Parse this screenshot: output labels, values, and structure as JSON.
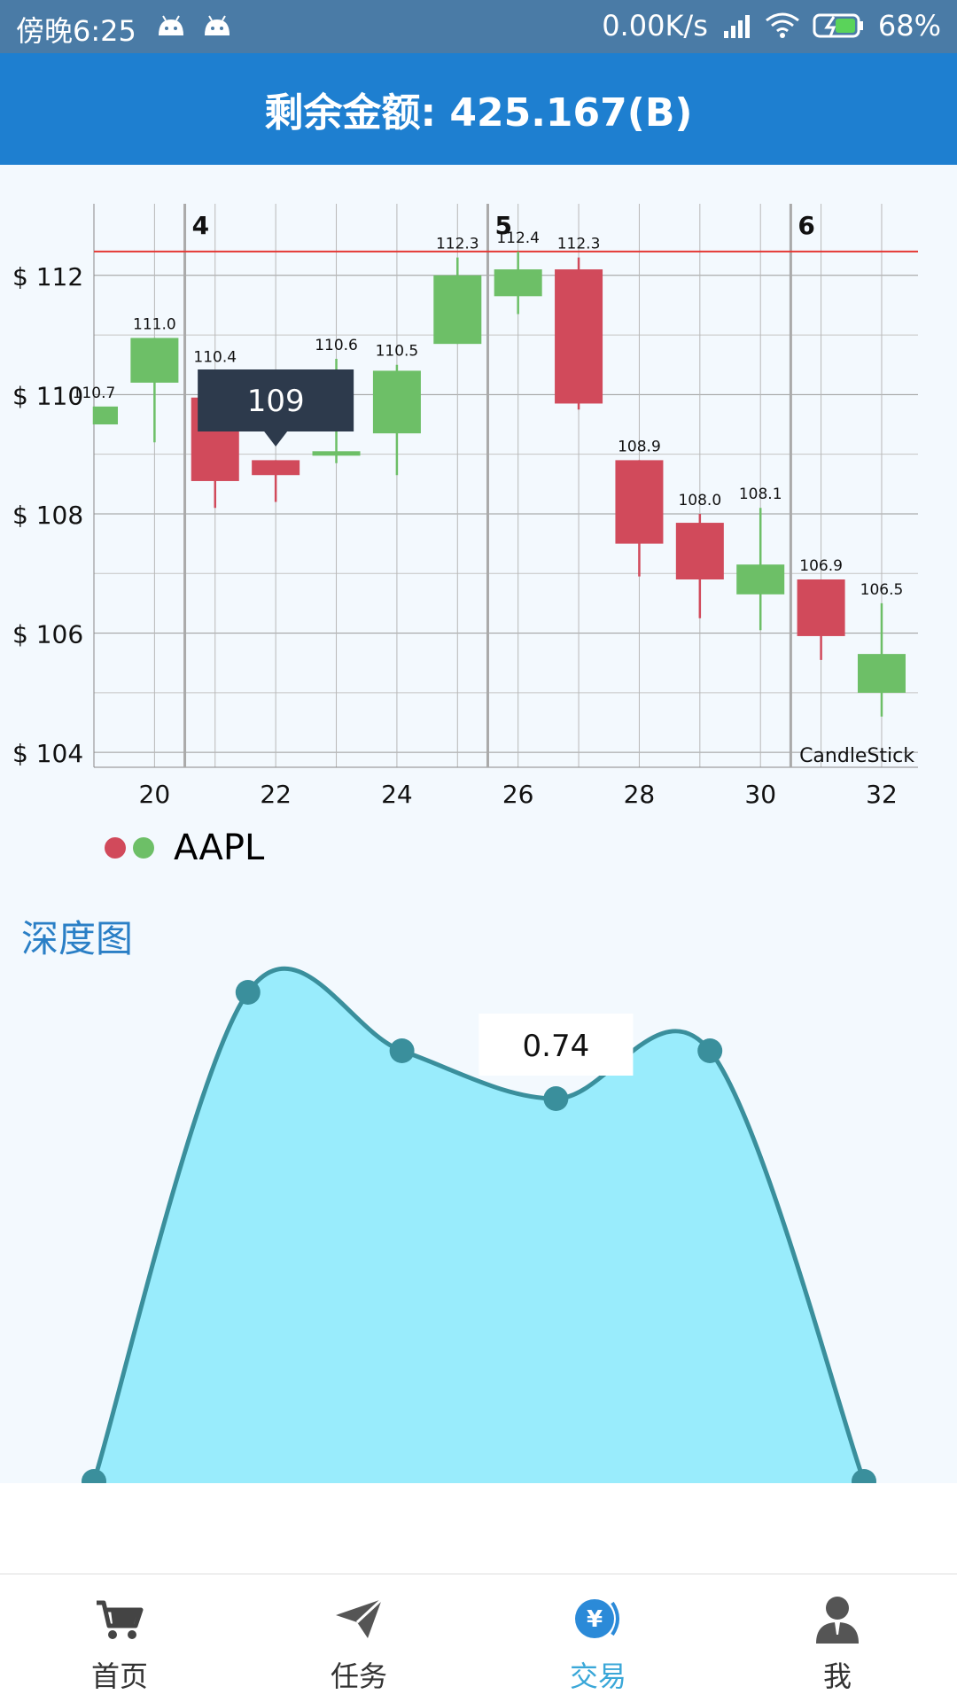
{
  "status_bar": {
    "time": "傍晚6:25",
    "network_speed": "0.00K/s",
    "battery": "68%",
    "icons": [
      "android-icon",
      "android-icon",
      "hd-signal-icon",
      "wifi-icon",
      "battery-charging-icon"
    ]
  },
  "header": {
    "title": "剩余金额: 425.167(B)"
  },
  "candlestick_chart": {
    "title": "CandleStick",
    "series_name": "AAPL",
    "colors": {
      "up": "#6dbf67",
      "down": "#d14a5b",
      "limit_line": "#e53935",
      "tooltip_bg": "#2d3a4c"
    },
    "tooltip_value": "109",
    "week_labels": [
      "4",
      "5",
      "6"
    ]
  },
  "depth_chart": {
    "title": "深度图",
    "tooltip_value": "0.74",
    "colors": {
      "fill": "#99ecfc",
      "line": "#3a8f9c"
    }
  },
  "chart_data": [
    {
      "type": "candlestick",
      "title": "CandleStick",
      "series": [
        {
          "name": "AAPL"
        }
      ],
      "x": [
        19,
        20,
        21,
        22,
        23,
        24,
        25,
        26,
        27,
        28,
        29,
        30,
        31,
        32
      ],
      "ohlc": [
        {
          "x": 19,
          "open": 109.5,
          "close": 109.8,
          "high": 109.8,
          "low": 109.5
        },
        {
          "x": 20,
          "open": 110.2,
          "close": 110.95,
          "high": 110.95,
          "low": 109.2
        },
        {
          "x": 21,
          "open": 109.95,
          "close": 108.55,
          "high": 110.4,
          "low": 108.1
        },
        {
          "x": 22,
          "open": 108.9,
          "close": 108.65,
          "high": 108.9,
          "low": 108.2
        },
        {
          "x": 23,
          "open": 109.0,
          "close": 109.05,
          "high": 110.6,
          "low": 108.85
        },
        {
          "x": 24,
          "open": 109.35,
          "close": 110.4,
          "high": 110.5,
          "low": 108.65
        },
        {
          "x": 25,
          "open": 110.85,
          "close": 112.0,
          "high": 112.3,
          "low": 110.85
        },
        {
          "x": 26,
          "open": 111.65,
          "close": 112.1,
          "high": 112.4,
          "low": 111.35
        },
        {
          "x": 27,
          "open": 112.1,
          "close": 109.85,
          "high": 112.3,
          "low": 109.75
        },
        {
          "x": 28,
          "open": 108.9,
          "close": 107.5,
          "high": 108.9,
          "low": 106.95
        },
        {
          "x": 29,
          "open": 107.85,
          "close": 106.9,
          "high": 108.0,
          "low": 106.25
        },
        {
          "x": 30,
          "open": 106.65,
          "close": 107.15,
          "high": 108.1,
          "low": 106.05
        },
        {
          "x": 31,
          "open": 106.9,
          "close": 105.95,
          "high": 106.9,
          "low": 105.55
        },
        {
          "x": 32,
          "open": 105.0,
          "close": 105.65,
          "high": 106.5,
          "low": 104.6
        }
      ],
      "high_labels": [
        {
          "x": 19,
          "label": "110.7"
        },
        {
          "x": 20,
          "label": "111.0"
        },
        {
          "x": 21,
          "label": "110.4"
        },
        {
          "x": 23,
          "label": "110.6"
        },
        {
          "x": 24,
          "label": "110.5"
        },
        {
          "x": 25,
          "label": "112.3"
        },
        {
          "x": 26,
          "label": "112.4"
        },
        {
          "x": 27,
          "label": "112.3"
        },
        {
          "x": 28,
          "label": "108.9"
        },
        {
          "x": 29,
          "label": "108.0"
        },
        {
          "x": 30,
          "label": "108.1"
        },
        {
          "x": 31,
          "label": "106.9"
        },
        {
          "x": 32,
          "label": "106.5"
        }
      ],
      "y_ticks": [
        {
          "value": 104,
          "label": "$ 104"
        },
        {
          "value": 106,
          "label": "$ 106"
        },
        {
          "value": 108,
          "label": "$ 108"
        },
        {
          "value": 110,
          "label": "$ 110"
        },
        {
          "value": 112,
          "label": "$ 112"
        }
      ],
      "x_ticks": [
        {
          "value": 20,
          "label": "20"
        },
        {
          "value": 22,
          "label": "22"
        },
        {
          "value": 24,
          "label": "24"
        },
        {
          "value": 26,
          "label": "26"
        },
        {
          "value": 28,
          "label": "28"
        },
        {
          "value": 30,
          "label": "30"
        },
        {
          "value": 32,
          "label": "32"
        }
      ],
      "week_separators": [
        {
          "x": 20.5,
          "label": "4"
        },
        {
          "x": 25.5,
          "label": "5"
        },
        {
          "x": 30.5,
          "label": "6"
        }
      ],
      "limit_line": 112.4,
      "xlim": [
        19,
        32.6
      ],
      "ylim": [
        103.75,
        113.2
      ],
      "tooltip": {
        "x": 22,
        "label": "109"
      }
    },
    {
      "type": "area",
      "title": "深度图",
      "x": [
        0,
        1,
        2,
        3,
        4,
        5
      ],
      "values": [
        0.0,
        0.92,
        0.81,
        0.72,
        0.81,
        0.0
      ],
      "tooltip": {
        "index": 3,
        "label": "0.74"
      }
    }
  ],
  "bottom_nav": {
    "items": [
      {
        "label": "首页",
        "icon": "cart-icon",
        "active": false
      },
      {
        "label": "任务",
        "icon": "paper-plane-icon",
        "active": false
      },
      {
        "label": "交易",
        "icon": "yen-coin-icon",
        "active": true
      },
      {
        "label": "我",
        "icon": "user-icon",
        "active": false
      }
    ]
  }
}
